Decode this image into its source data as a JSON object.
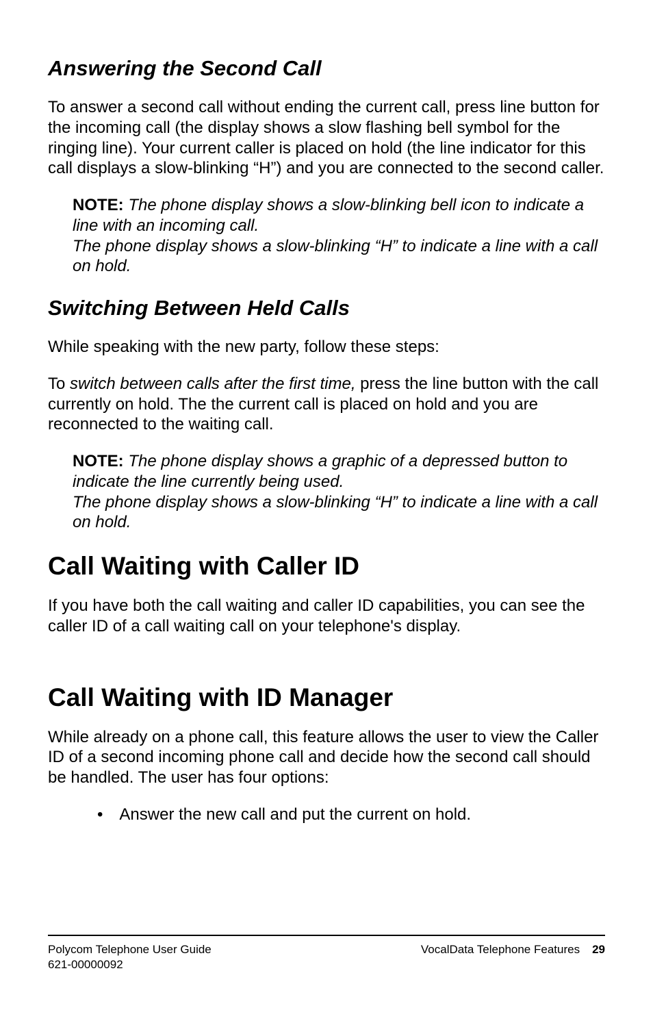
{
  "s1": {
    "heading": "Answering the Second Call",
    "para": "To answer a second call without ending the current call, press line button for the incoming call (the display shows a slow flashing bell symbol for the ringing line). Your current caller is placed on hold (the line indicator for this call displays a slow-blinking “H”) and you are connected to the second caller.",
    "note_label": "NOTE:",
    "note_body": " The phone display shows a slow-blinking bell icon to indicate a line with an incoming call.\nThe phone display shows a slow-blinking “H” to indicate a line with a call on hold."
  },
  "s2": {
    "heading": "Switching Between Held Calls",
    "para1": "While speaking with the new party, follow these steps:",
    "para2_pre": "To ",
    "para2_ital": "switch between calls after the first time,",
    "para2_post": " press the line button with the call currently on hold. The the current call is placed on hold and you are reconnected to the waiting call.",
    "note_label": "NOTE:",
    "note_body": " The phone display shows a graphic of a depressed button to indicate the line currently being used.\nThe phone display shows a slow-blinking “H” to indicate a line with a call on hold."
  },
  "s3": {
    "heading": "Call Waiting with Caller ID",
    "para": "If you have both the call waiting and caller ID capabilities, you can see the caller ID of a call waiting call on your telephone's display."
  },
  "s4": {
    "heading": "Call Waiting with ID Manager",
    "para": "While already on a phone call, this feature allows the user to view the Caller ID of a second incoming phone call and decide how the second call should be handled. The user has four options:",
    "bullet1": "Answer the new call and put the current on hold."
  },
  "footer": {
    "left1": "Polycom Telephone User Guide",
    "left2": "621-00000092",
    "right_label": "VocalData Telephone Features",
    "page": "29"
  }
}
